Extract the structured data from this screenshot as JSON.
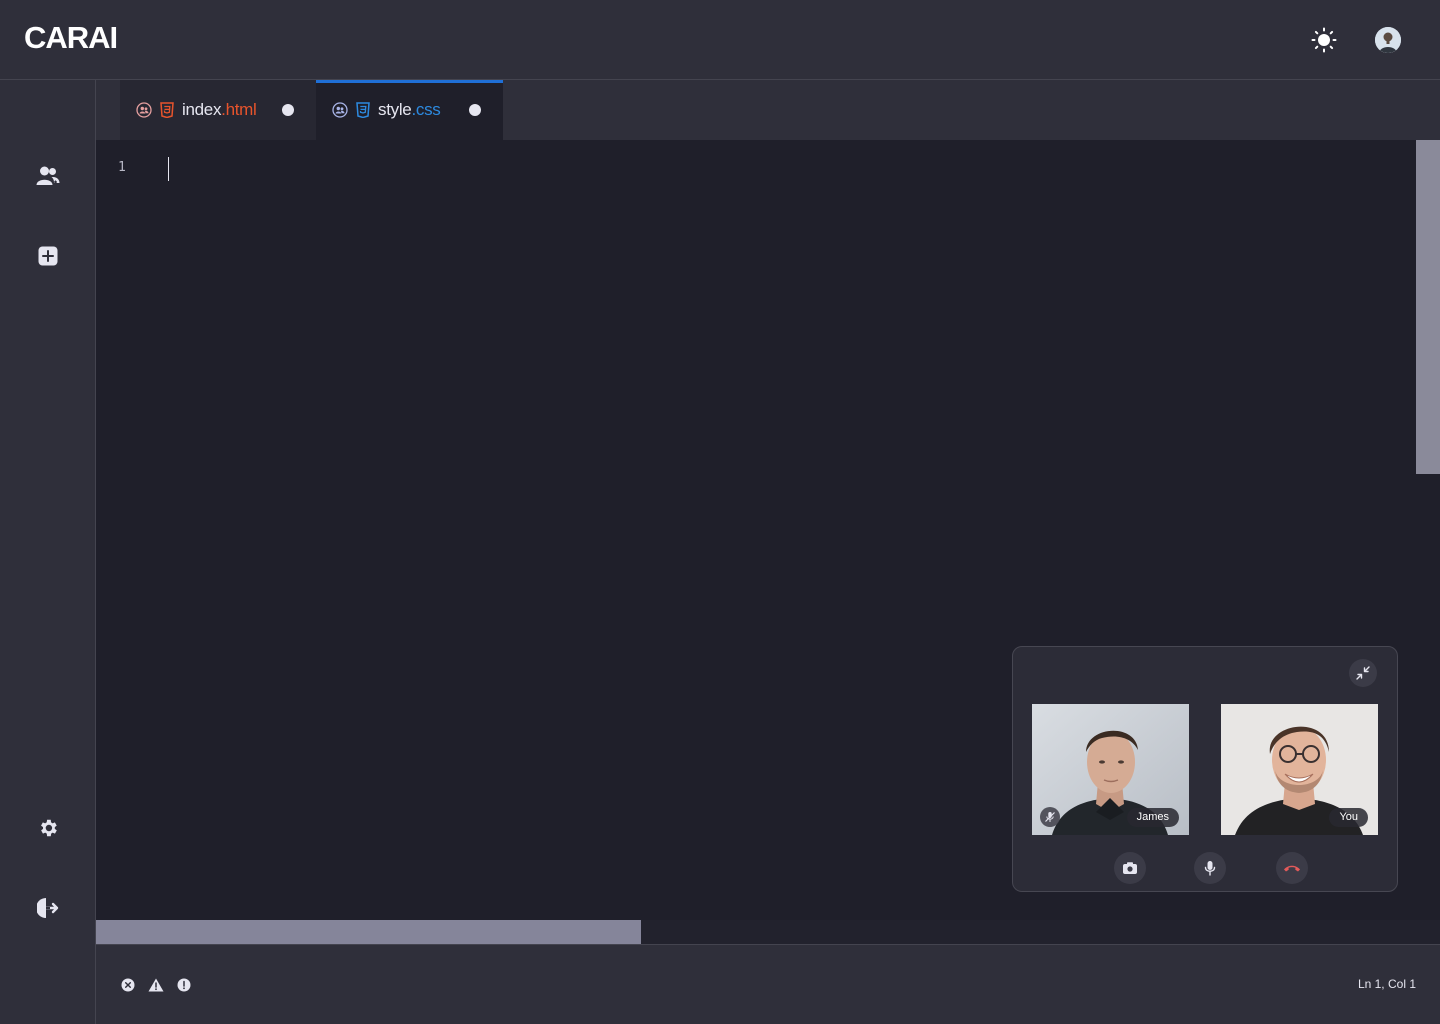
{
  "app": {
    "brand": "CARAI"
  },
  "header": {
    "theme_icon": "sun-icon",
    "avatar_icon": "user-avatar"
  },
  "sidebar": {
    "items": [
      {
        "icon": "users-icon"
      },
      {
        "icon": "add-square-icon"
      },
      {
        "icon": "gear-icon"
      },
      {
        "icon": "logout-icon"
      }
    ]
  },
  "tabs": [
    {
      "base": "index",
      "ext": ".html",
      "type": "html-icon",
      "unsaved": true,
      "active": false
    },
    {
      "base": "style",
      "ext": ".css",
      "type": "css-icon",
      "unsaved": true,
      "active": true
    }
  ],
  "editor": {
    "line_numbers": [
      "1"
    ],
    "content": ""
  },
  "statusbar": {
    "cursor_position": "Ln 1,  Col 1",
    "icons": [
      "error-icon",
      "warning-icon",
      "info-icon"
    ]
  },
  "call": {
    "participants": [
      {
        "name": "James",
        "muted": true
      },
      {
        "name": "You",
        "muted": false
      }
    ],
    "controls": [
      "camera-icon",
      "microphone-icon",
      "hang-up-icon"
    ]
  },
  "colors": {
    "background": "#2f2f3a",
    "editor": "#1f1f2a",
    "accent": "#1f6fd6",
    "html": "#e8542c",
    "css": "#2d8ae0",
    "hangup": "#e45a5a"
  }
}
